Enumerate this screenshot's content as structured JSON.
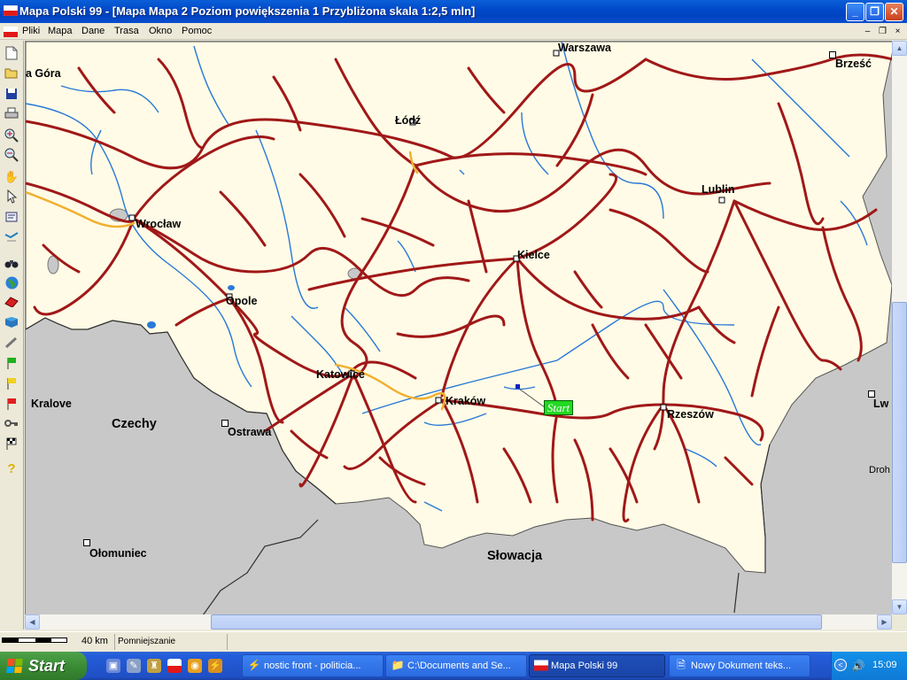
{
  "window": {
    "title": "Mapa Polski 99 - [Mapa Mapa 2 Poziom powiększenia 1 Przybliżona skala 1:2,5 mln]",
    "controls": [
      "_",
      "❐",
      "✕"
    ]
  },
  "menu": {
    "items": [
      "Pliki",
      "Mapa",
      "Dane",
      "Trasa",
      "Okno",
      "Pomoc"
    ],
    "mdi_controls": [
      "–",
      "❐",
      "×"
    ]
  },
  "toolbar": {
    "tools": [
      "new-file-icon",
      "open-folder-icon",
      "save-icon",
      "print-icon",
      "zoom-in-icon",
      "zoom-out-icon",
      "hand-pan-icon",
      "pointer-icon",
      "info-panel-icon",
      "route-icon",
      "binoculars-icon",
      "globe-icon",
      "eraser-icon",
      "book-icon",
      "ruler-icon",
      "green-flag-icon",
      "yellow-flag-icon",
      "red-flag-icon",
      "key-icon",
      "checkered-flag-icon",
      "help-icon"
    ]
  },
  "map": {
    "cities": [
      "Warszawa",
      "Brześć",
      "a Góra",
      "Łódź",
      "Lublin",
      "Wrocław",
      "Kielce",
      "Opole",
      "Katowice",
      "Kraków",
      "Rzeszów",
      "Kralove",
      "Czechy",
      "Ostrawa",
      "Ołomuniec",
      "Słowacja",
      "Lw",
      "Droh"
    ],
    "start_label": "Start",
    "colors": {
      "land": "#fffbe6",
      "foreign": "#c8c8c8",
      "road": "#a01818",
      "river": "#2878d8",
      "highway": "#f0b030"
    }
  },
  "statusbar": {
    "scale": "40 km",
    "status": "Pomniejszanie"
  },
  "taskbar": {
    "start": "Start",
    "tasks": [
      {
        "label": "nostic front - politicia...",
        "icon": "bolt-icon"
      },
      {
        "label": "C:\\Documents and Se...",
        "icon": "folder-icon"
      },
      {
        "label": "Mapa Polski 99",
        "icon": "poland-flag-icon"
      },
      {
        "label": "Nowy Dokument teks...",
        "icon": "document-icon"
      }
    ],
    "clock": "15:09"
  }
}
